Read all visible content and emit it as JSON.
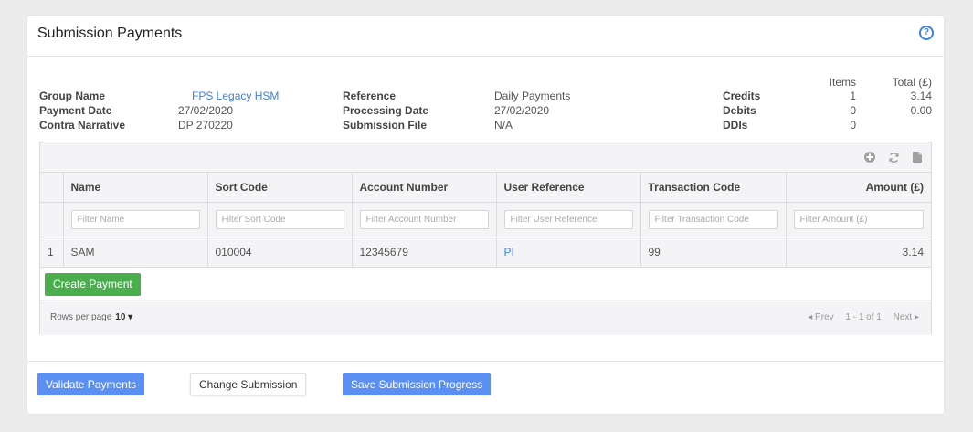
{
  "header": {
    "title": "Submission Payments",
    "help_glyph": "?"
  },
  "summary": {
    "group_name_label": "Group Name",
    "group_name_value": "FPS Legacy HSM",
    "payment_date_label": "Payment Date",
    "payment_date_value": "27/02/2020",
    "contra_label": "Contra Narrative",
    "contra_value": "DP 270220",
    "reference_label": "Reference",
    "reference_value": "Daily Payments",
    "processing_date_label": "Processing Date",
    "processing_date_value": "27/02/2020",
    "submission_file_label": "Submission File",
    "submission_file_value": "N/A",
    "totals": {
      "items_header": "Items",
      "total_header": "Total (£)",
      "rows": [
        {
          "label": "Credits",
          "items": "1",
          "total": "3.14"
        },
        {
          "label": "Debits",
          "items": "0",
          "total": "0.00"
        },
        {
          "label": "DDIs",
          "items": "0",
          "total": ""
        }
      ]
    }
  },
  "grid": {
    "toolbar_icons": [
      "add-icon",
      "refresh-icon",
      "file-icon"
    ],
    "columns": [
      "Name",
      "Sort Code",
      "Account Number",
      "User Reference",
      "Transaction Code",
      "Amount (£)"
    ],
    "filters": [
      "Filter Name",
      "Filter Sort Code",
      "Filter Account Number",
      "Filter User Reference",
      "Filter Transaction Code",
      "Filter Amount (£)"
    ],
    "rows": [
      {
        "index": "1",
        "name": "SAM",
        "sort_code": "010004",
        "account_number": "12345679",
        "user_reference": "PI",
        "transaction_code": "99",
        "amount": "3.14"
      }
    ],
    "create_payment_label": "Create Payment",
    "pager": {
      "rows_per_page_label": "Rows per page",
      "rows_per_page_value": "10 ▾",
      "prev": "◂ Prev",
      "range": "1 - 1 of 1",
      "next": "Next ▸"
    }
  },
  "footer": {
    "validate_label": "Validate Payments",
    "change_label": "Change Submission",
    "save_label": "Save Submission Progress"
  },
  "colors": {
    "accent_blue": "#5b8ff2",
    "link_blue": "#3f7fe4",
    "green": "#4aae4f"
  }
}
